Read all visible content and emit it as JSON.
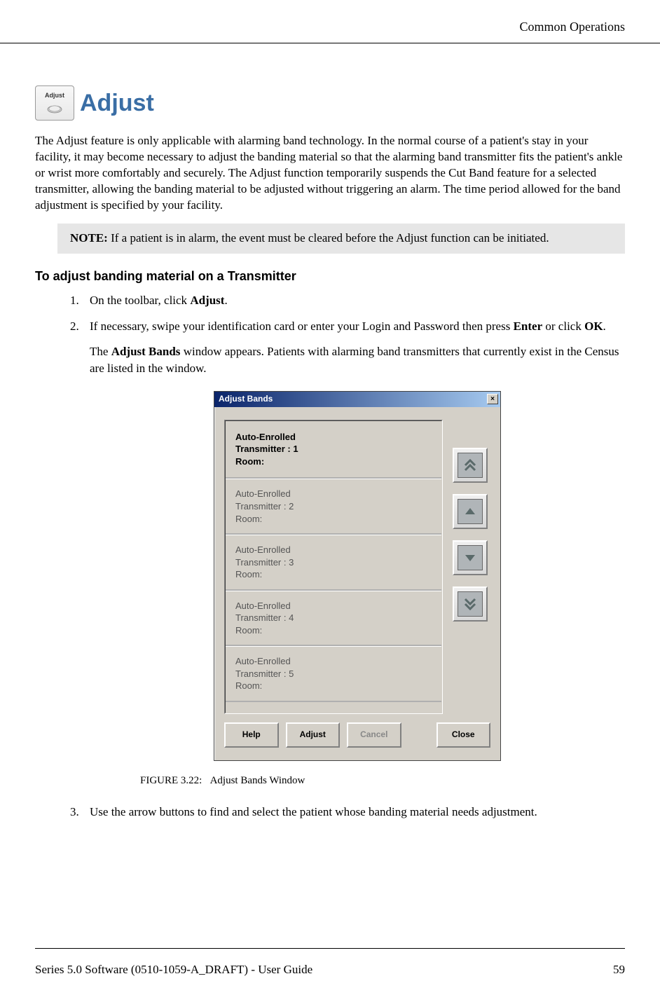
{
  "header": {
    "section_title": "Common Operations"
  },
  "toolbar_icon": {
    "label": "Adjust"
  },
  "main": {
    "heading": "Adjust",
    "intro": "The Adjust feature is only applicable with alarming band technology. In the normal course of a patient's stay in your facility, it may become necessary to adjust the banding material so that the alarming band transmitter fits the patient's ankle or wrist more comfortably and securely. The Adjust function temporarily suspends the Cut Band feature for a selected transmitter, allowing the banding material to be adjusted without triggering an alarm. The time period allowed for the band adjustment is specified by your facility.",
    "note_label": "NOTE:",
    "note_text": " If a patient is in alarm, the event must be cleared before the Adjust function can be initiated.",
    "subheading": "To adjust banding material on a Transmitter",
    "steps": {
      "s1_pre": "On the toolbar, click ",
      "s1_bold": "Adjust",
      "s1_post": ".",
      "s2_pre": "If necessary, swipe your identification card or enter your Login and Password then press ",
      "s2_bold1": "Enter",
      "s2_mid": " or click ",
      "s2_bold2": "OK",
      "s2_post": ".",
      "s2_cont_pre": "The ",
      "s2_cont_bold": "Adjust Bands",
      "s2_cont_post": " window appears. Patients with alarming band transmitters that currently exist in the Census are listed in the window.",
      "s3": "Use the arrow buttons to find and select the patient whose banding material needs adjustment."
    },
    "figure_caption_label": "FIGURE 3.22:",
    "figure_caption_text": "Adjust Bands Window"
  },
  "dialog": {
    "title": "Adjust Bands",
    "close": "×",
    "items": [
      {
        "line1": "Auto-Enrolled",
        "line2": "Transmitter : 1",
        "line3": "Room:"
      },
      {
        "line1": "Auto-Enrolled",
        "line2": "Transmitter : 2",
        "line3": "Room:"
      },
      {
        "line1": "Auto-Enrolled",
        "line2": "Transmitter : 3",
        "line3": "Room:"
      },
      {
        "line1": "Auto-Enrolled",
        "line2": "Transmitter : 4",
        "line3": "Room:"
      },
      {
        "line1": "Auto-Enrolled",
        "line2": "Transmitter : 5",
        "line3": "Room:"
      }
    ],
    "buttons": {
      "help": "Help",
      "adjust": "Adjust",
      "cancel": "Cancel",
      "close": "Close"
    }
  },
  "footer": {
    "left": "Series 5.0 Software (0510-1059-A_DRAFT) - User Guide",
    "right": "59"
  }
}
